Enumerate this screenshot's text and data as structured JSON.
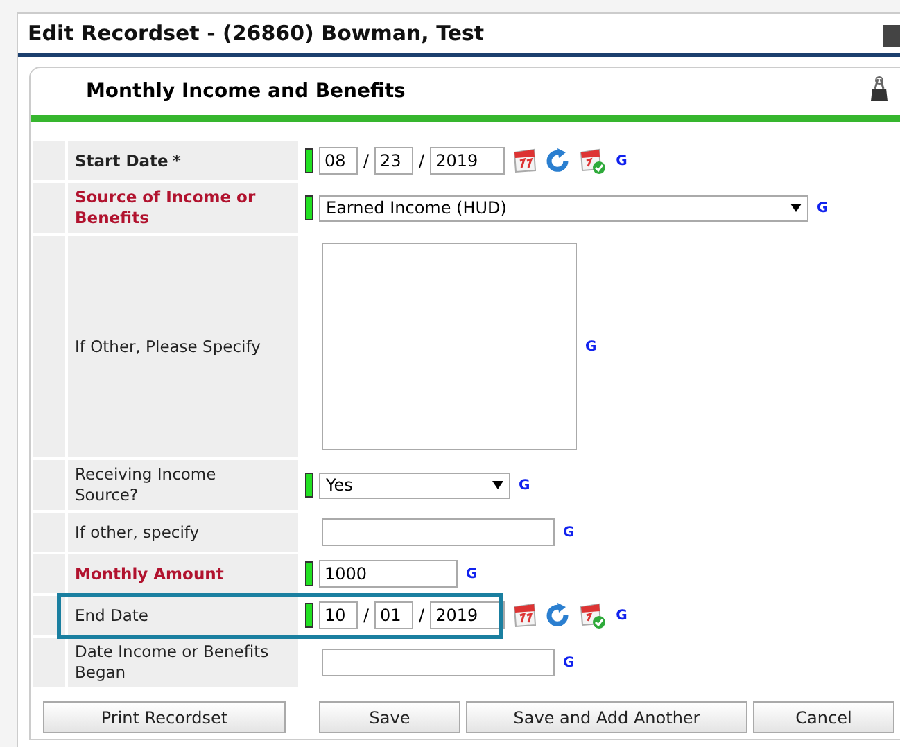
{
  "window": {
    "title": "Edit Recordset - (26860) Bowman, Test"
  },
  "section": {
    "title": "Monthly Income and Benefits"
  },
  "rows": [
    {
      "label": "Start Date",
      "asterisk": "*",
      "bold": true,
      "required": false,
      "kind": "date",
      "indicator": true,
      "highlighted": false,
      "separator": "/",
      "month": "08",
      "day": "23",
      "year": "2019",
      "help": "G"
    },
    {
      "label": "Source of Income or Benefits",
      "bold": true,
      "required": true,
      "kind": "select",
      "indicator": true,
      "highlighted": false,
      "value": "Earned Income (HUD)",
      "wide": true,
      "help": "G"
    },
    {
      "label": "If Other, Please Specify",
      "bold": false,
      "required": false,
      "kind": "textarea",
      "indicator": false,
      "highlighted": false,
      "help": "G"
    },
    {
      "label": "Receiving Income Source?",
      "bold": false,
      "required": false,
      "kind": "select",
      "indicator": true,
      "highlighted": false,
      "value": "Yes",
      "wide": false,
      "help": "G"
    },
    {
      "label": "If other, specify",
      "bold": false,
      "required": false,
      "kind": "text",
      "indicator": false,
      "highlighted": false,
      "wide": true,
      "help": "G"
    },
    {
      "label": "Monthly Amount",
      "bold": true,
      "required": true,
      "kind": "text",
      "indicator": true,
      "highlighted": false,
      "value": "1000",
      "wide": false,
      "help": "G"
    },
    {
      "label": "End Date",
      "bold": false,
      "required": false,
      "kind": "date",
      "indicator": true,
      "highlighted": true,
      "separator": "/",
      "month": "10",
      "day": "01",
      "year": "2019",
      "help": "G"
    },
    {
      "label": "Date Income or Benefits Began",
      "bold": false,
      "required": false,
      "kind": "text",
      "indicator": false,
      "highlighted": false,
      "wide": true,
      "help": "G"
    }
  ],
  "buttons": [
    {
      "label": "Print Recordset",
      "kind": "print"
    },
    {
      "label": "Save",
      "kind": "save"
    },
    {
      "label": "Save and Add Another",
      "kind": "save-add"
    },
    {
      "label": "Cancel",
      "kind": "cancel"
    }
  ]
}
